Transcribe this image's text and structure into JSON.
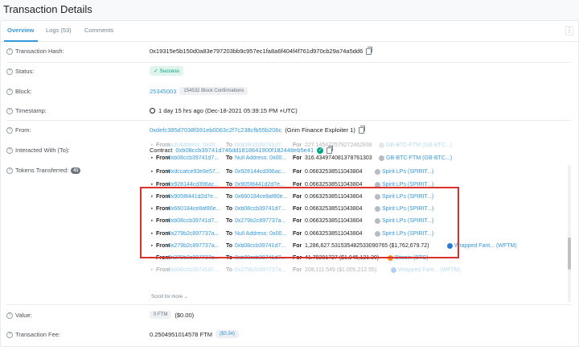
{
  "page_title": "Transaction Details",
  "tabs": [
    {
      "label": "Overview"
    },
    {
      "label": "Logs (53)"
    },
    {
      "label": "Comments"
    }
  ],
  "kebab_label": "⋮",
  "rows": {
    "hash": {
      "label": "Transaction Hash:",
      "value": "0x19315e5b150d0a83e797203bb9c957ec1fa8a6f404f4f761d970cb29a74a5dd6"
    },
    "status": {
      "label": "Status:",
      "value": "Success"
    },
    "block": {
      "label": "Block:",
      "value": "25345003",
      "confirmations": "154532 Block Confirmations"
    },
    "timestamp": {
      "label": "Timestamp:",
      "value": "1 day 15 hrs ago (Dec-18-2021 05:39:15 PM +UTC)"
    },
    "from": {
      "label": "From:",
      "address": "0xdefc385d7038f391eb0063c2f7c238cfb55b206c",
      "tag": "(Grim Finance Exploiter 1)"
    },
    "interacted": {
      "label": "Interacted With (To):",
      "prefix": "Contract",
      "address": "0xb08ccb39741d746dd1818641900f182448eb5e41"
    },
    "tokens": {
      "label": "Tokens Transferred:",
      "count": "41"
    },
    "value": {
      "label": "Value:",
      "badge": "0 FTM",
      "usd": "($0.00)"
    },
    "fee": {
      "label": "Transaction Fee:",
      "value": "0.2504951014578 FTM",
      "usd": "($0.34)"
    }
  },
  "transfer_labels": {
    "from": "From",
    "to": "To",
    "for": "For"
  },
  "transfers": [
    {
      "from": "Null Address: 0x000...",
      "to": "0xb08ccb39741d7...",
      "amount": "227.145472579272462838",
      "token": "GB-BTC-FTM (GB-BTC...)",
      "icon": "grey"
    },
    {
      "from": "0xb08ccb39741d7...",
      "to": "Null Address: 0x00...",
      "amount": "316.434974081378761303",
      "token": "GB-BTC-FTM (GB-BTC...)",
      "icon": "grey"
    },
    {
      "from": "0xdccafce93e6e57...",
      "to": "0x928144cd396ac...",
      "amount": "0.06632538511043804",
      "token": "Spirit LPs (SPIRIT...)",
      "icon": "grey"
    },
    {
      "from": "0x928144cd396ac...",
      "to": "0x905f8441d2d7e...",
      "amount": "0.06632538511043804",
      "token": "Spirit LPs (SPIRIT...)",
      "icon": "grey"
    },
    {
      "from": "0x905f8441d2d7e...",
      "to": "0x660184ce8af80e...",
      "amount": "0.06632538511043804",
      "token": "Spirit LPs (SPIRIT...)",
      "icon": "grey"
    },
    {
      "from": "0x660184ce8af80e...",
      "to": "0xb08ccb39741d7...",
      "amount": "0.06632538511043804",
      "token": "Spirit LPs (SPIRIT...)",
      "icon": "grey"
    },
    {
      "from": "0xb08ccb39741d7...",
      "to": "0x279b2c897737a...",
      "amount": "0.06632538511043804",
      "token": "Spirit LPs (SPIRIT...)",
      "icon": "grey"
    },
    {
      "from": "0x279b2c897737a...",
      "to": "Null Address: 0x00...",
      "amount": "0.06632538511043804",
      "token": "Spirit LPs (SPIRIT...)",
      "icon": "grey"
    },
    {
      "from": "0x279b2c897737a...",
      "to": "0xb08ccb39741d7...",
      "amount": "1,286,627.531535482533090765 ($1,762,679.72)",
      "token": "Wrapped Fant... (WFTM)",
      "icon": "wftm"
    },
    {
      "from": "0x279b2c897737a...",
      "to": "0xb08ccb39741d7...",
      "amount": "41.79281727 ($1,945,121.30)",
      "token": "Bitcoin (BTC)",
      "icon": "btc"
    },
    {
      "from": "0xb08ccb39741d7...",
      "to": "0x279b2c897737a...",
      "amount": "208,111.549 ($1,005,212.55)",
      "token": "Wrapped Fant... (WFTM)",
      "icon": "wftm"
    }
  ],
  "scroll_more": "Scroll for more"
}
